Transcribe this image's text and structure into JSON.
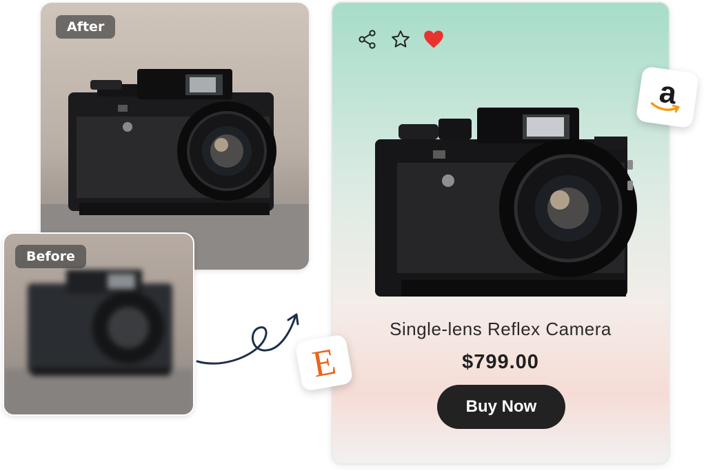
{
  "after_panel": {
    "label": "After"
  },
  "before_panel": {
    "label": "Before"
  },
  "product": {
    "title": "Single-lens Reflex Camera",
    "price": "$799.00",
    "buy_label": "Buy Now",
    "actions": [
      {
        "icon": "share-icon"
      },
      {
        "icon": "star-icon"
      },
      {
        "icon": "heart-icon",
        "color": "#e8332f"
      }
    ]
  },
  "marketplaces": {
    "amazon": {
      "letter": "a",
      "accent": "#f29b16"
    },
    "etsy": {
      "letter": "E",
      "accent": "#e8651a"
    }
  },
  "colors": {
    "button_bg": "#222222",
    "card_gradient_top": "#a6ddc8",
    "card_gradient_bottom": "#f6dcd6",
    "arrow": "#1d2f48"
  }
}
